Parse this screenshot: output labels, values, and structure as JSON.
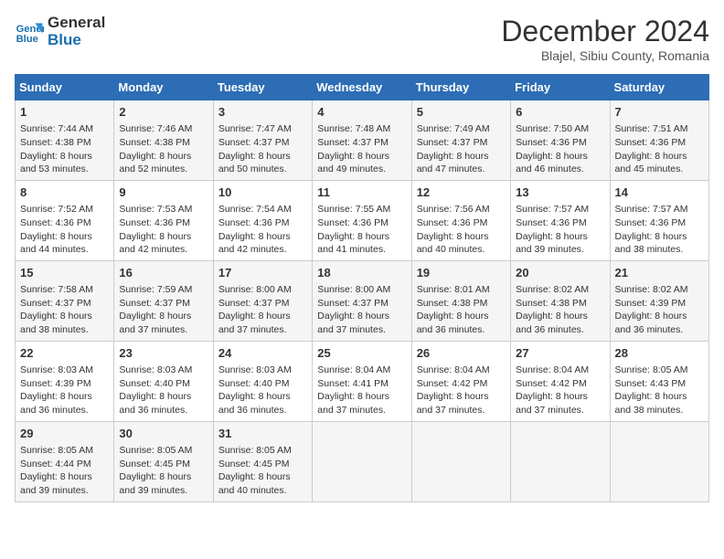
{
  "header": {
    "logo_line1": "General",
    "logo_line2": "Blue",
    "month": "December 2024",
    "location": "Blajel, Sibiu County, Romania"
  },
  "weekdays": [
    "Sunday",
    "Monday",
    "Tuesday",
    "Wednesday",
    "Thursday",
    "Friday",
    "Saturday"
  ],
  "weeks": [
    [
      {
        "day": "1",
        "sunrise": "7:44 AM",
        "sunset": "4:38 PM",
        "daylight": "8 hours and 53 minutes."
      },
      {
        "day": "2",
        "sunrise": "7:46 AM",
        "sunset": "4:38 PM",
        "daylight": "8 hours and 52 minutes."
      },
      {
        "day": "3",
        "sunrise": "7:47 AM",
        "sunset": "4:37 PM",
        "daylight": "8 hours and 50 minutes."
      },
      {
        "day": "4",
        "sunrise": "7:48 AM",
        "sunset": "4:37 PM",
        "daylight": "8 hours and 49 minutes."
      },
      {
        "day": "5",
        "sunrise": "7:49 AM",
        "sunset": "4:37 PM",
        "daylight": "8 hours and 47 minutes."
      },
      {
        "day": "6",
        "sunrise": "7:50 AM",
        "sunset": "4:36 PM",
        "daylight": "8 hours and 46 minutes."
      },
      {
        "day": "7",
        "sunrise": "7:51 AM",
        "sunset": "4:36 PM",
        "daylight": "8 hours and 45 minutes."
      }
    ],
    [
      {
        "day": "8",
        "sunrise": "7:52 AM",
        "sunset": "4:36 PM",
        "daylight": "8 hours and 44 minutes."
      },
      {
        "day": "9",
        "sunrise": "7:53 AM",
        "sunset": "4:36 PM",
        "daylight": "8 hours and 42 minutes."
      },
      {
        "day": "10",
        "sunrise": "7:54 AM",
        "sunset": "4:36 PM",
        "daylight": "8 hours and 42 minutes."
      },
      {
        "day": "11",
        "sunrise": "7:55 AM",
        "sunset": "4:36 PM",
        "daylight": "8 hours and 41 minutes."
      },
      {
        "day": "12",
        "sunrise": "7:56 AM",
        "sunset": "4:36 PM",
        "daylight": "8 hours and 40 minutes."
      },
      {
        "day": "13",
        "sunrise": "7:57 AM",
        "sunset": "4:36 PM",
        "daylight": "8 hours and 39 minutes."
      },
      {
        "day": "14",
        "sunrise": "7:57 AM",
        "sunset": "4:36 PM",
        "daylight": "8 hours and 38 minutes."
      }
    ],
    [
      {
        "day": "15",
        "sunrise": "7:58 AM",
        "sunset": "4:37 PM",
        "daylight": "8 hours and 38 minutes."
      },
      {
        "day": "16",
        "sunrise": "7:59 AM",
        "sunset": "4:37 PM",
        "daylight": "8 hours and 37 minutes."
      },
      {
        "day": "17",
        "sunrise": "8:00 AM",
        "sunset": "4:37 PM",
        "daylight": "8 hours and 37 minutes."
      },
      {
        "day": "18",
        "sunrise": "8:00 AM",
        "sunset": "4:37 PM",
        "daylight": "8 hours and 37 minutes."
      },
      {
        "day": "19",
        "sunrise": "8:01 AM",
        "sunset": "4:38 PM",
        "daylight": "8 hours and 36 minutes."
      },
      {
        "day": "20",
        "sunrise": "8:02 AM",
        "sunset": "4:38 PM",
        "daylight": "8 hours and 36 minutes."
      },
      {
        "day": "21",
        "sunrise": "8:02 AM",
        "sunset": "4:39 PM",
        "daylight": "8 hours and 36 minutes."
      }
    ],
    [
      {
        "day": "22",
        "sunrise": "8:03 AM",
        "sunset": "4:39 PM",
        "daylight": "8 hours and 36 minutes."
      },
      {
        "day": "23",
        "sunrise": "8:03 AM",
        "sunset": "4:40 PM",
        "daylight": "8 hours and 36 minutes."
      },
      {
        "day": "24",
        "sunrise": "8:03 AM",
        "sunset": "4:40 PM",
        "daylight": "8 hours and 36 minutes."
      },
      {
        "day": "25",
        "sunrise": "8:04 AM",
        "sunset": "4:41 PM",
        "daylight": "8 hours and 37 minutes."
      },
      {
        "day": "26",
        "sunrise": "8:04 AM",
        "sunset": "4:42 PM",
        "daylight": "8 hours and 37 minutes."
      },
      {
        "day": "27",
        "sunrise": "8:04 AM",
        "sunset": "4:42 PM",
        "daylight": "8 hours and 37 minutes."
      },
      {
        "day": "28",
        "sunrise": "8:05 AM",
        "sunset": "4:43 PM",
        "daylight": "8 hours and 38 minutes."
      }
    ],
    [
      {
        "day": "29",
        "sunrise": "8:05 AM",
        "sunset": "4:44 PM",
        "daylight": "8 hours and 39 minutes."
      },
      {
        "day": "30",
        "sunrise": "8:05 AM",
        "sunset": "4:45 PM",
        "daylight": "8 hours and 39 minutes."
      },
      {
        "day": "31",
        "sunrise": "8:05 AM",
        "sunset": "4:45 PM",
        "daylight": "8 hours and 40 minutes."
      },
      null,
      null,
      null,
      null
    ]
  ]
}
